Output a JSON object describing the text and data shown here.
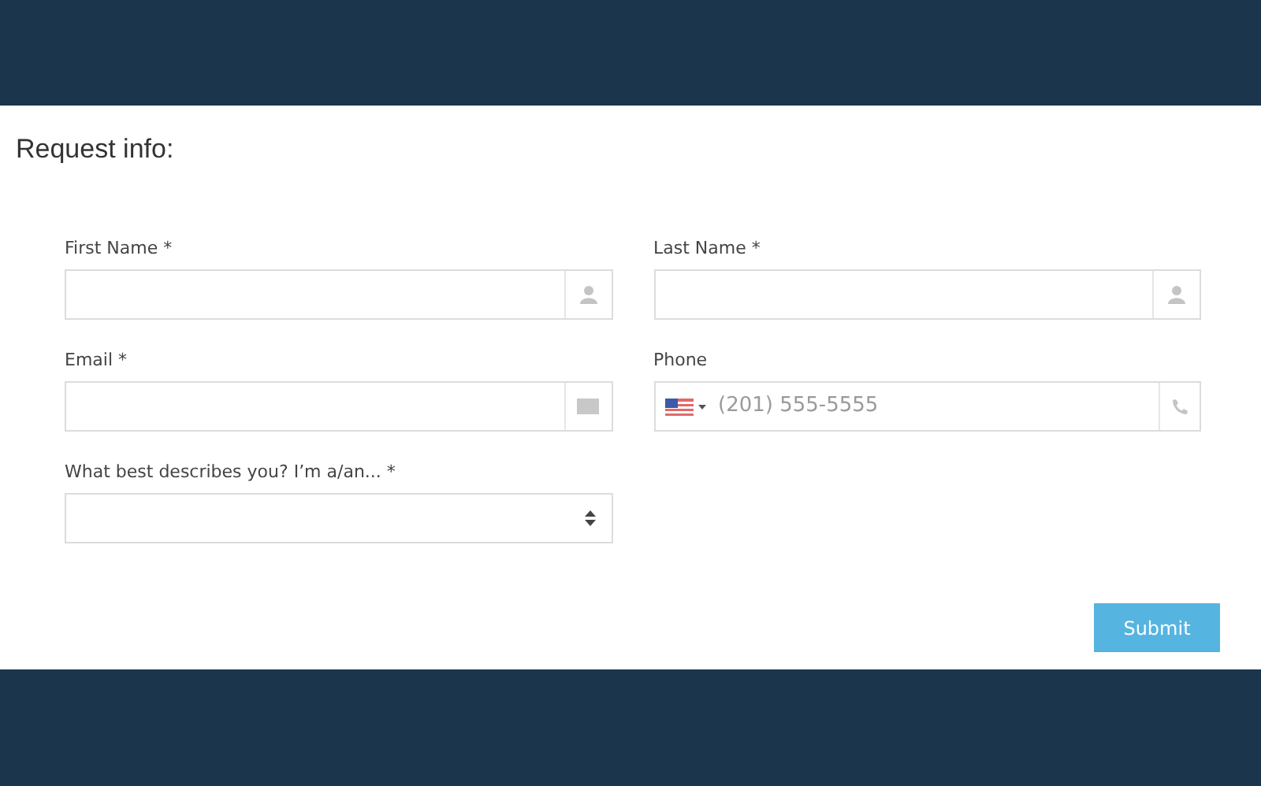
{
  "form": {
    "title": "Request info:",
    "fields": [
      {
        "kind": "name",
        "label": "First Name *"
      },
      {
        "kind": "name",
        "label": "Last Name *"
      },
      {
        "kind": "email",
        "label": "Email *"
      },
      {
        "kind": "phone",
        "label": "Phone",
        "placeholder": "(201) 555-5555"
      },
      {
        "kind": "select",
        "label": "What best describes you? I’m a/an... *"
      }
    ],
    "submit": "Submit"
  }
}
